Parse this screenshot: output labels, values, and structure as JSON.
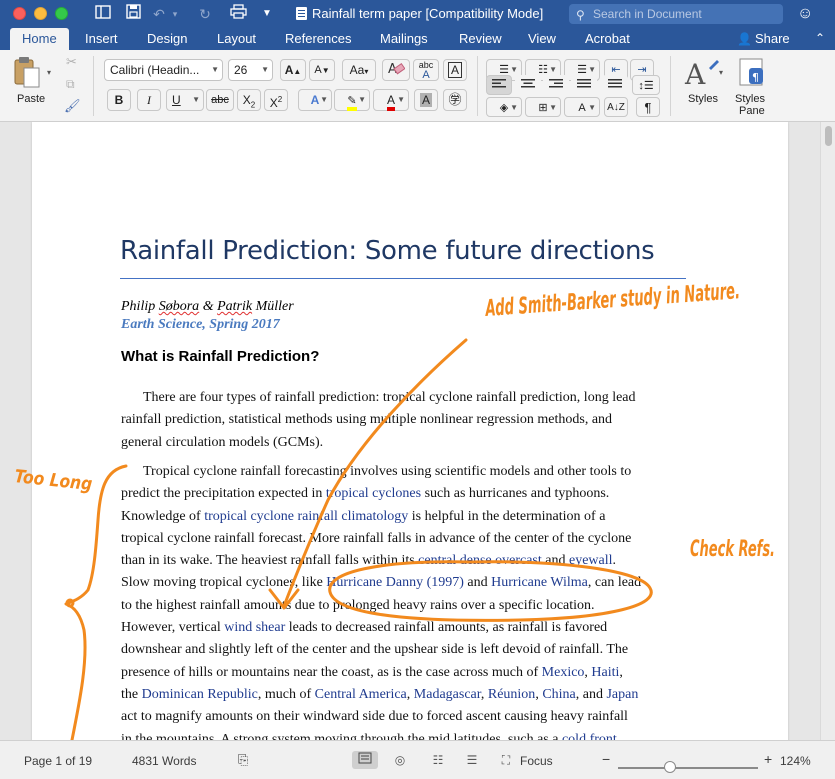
{
  "window": {
    "title": "Rainfall term paper [Compatibility Mode]",
    "search_placeholder": "Search in Document"
  },
  "ribbon_tabs": [
    "Home",
    "Insert",
    "Design",
    "Layout",
    "References",
    "Mailings",
    "Review",
    "View",
    "Acrobat"
  ],
  "share_label": "Share",
  "ribbon": {
    "paste_label": "Paste",
    "font_name": "Calibri (Headin...",
    "font_size": "26",
    "styles_label": "Styles",
    "styles_pane_label_1": "Styles",
    "styles_pane_label_2": "Pane"
  },
  "document": {
    "title": "Rainfall Prediction: Some future directions",
    "authors_a": "Philip",
    "authors_b": "Søbora",
    "authors_c": "&",
    "authors_d": "Patrik",
    "authors_e": "Müller",
    "course": "Earth Science, Spring 2017",
    "heading": "What is Rainfall Prediction?",
    "para1": [
      "There are four types of rainfall prediction: tropical cyclone rainfall prediction, long lead",
      "rainfall prediction, statistical methods using multiple nonlinear regression methods, and",
      "general circulation models (GCMs)."
    ],
    "para2": {
      "l1": "Tropical cyclone rainfall forecasting involves using scientific models and other tools to",
      "l2a": "predict the precipitation expected in ",
      "l2link": "tropical cyclones",
      "l2b": " such as hurricanes and typhoons.",
      "l3a": "Knowledge of ",
      "l3link": "tropical cyclone rainfall climatology",
      "l3b": " is helpful in the determination of a",
      "l4": "tropical cyclone rainfall forecast. More rainfall falls in advance of the center of the cyclone",
      "l5a": "than in its wake. The heaviest rainfall falls within its ",
      "l5link1": "central dense overcast",
      "l5b": " and ",
      "l5link2": "eyewall",
      "l5c": ".",
      "l6a": "Slow moving tropical cyclones, like ",
      "l6link1": "Hurricane Danny (1997)",
      "l6b": " and ",
      "l6link2": "Hurricane Wilma",
      "l6c": ", can lead",
      "l7": "to the highest rainfall amounts due to prolonged heavy rains over a specific location.",
      "l8a": "However, vertical ",
      "l8link": "wind shear",
      "l8b": " leads to decreased rainfall amounts, as rainfall is favored",
      "l9": "downshear and slightly left of the center and the upshear side is left devoid of rainfall. The",
      "l10a": "presence of hills or mountains near the coast, as is the case across much of ",
      "l10link1": "Mexico",
      "l10b": ", ",
      "l10link2": "Haiti",
      "l10c": ",",
      "l11a": "the ",
      "l11link1": "Dominican Republic",
      "l11b": ", much of ",
      "l11link2": "Central America",
      "l11c": ", ",
      "l11link3": "Madagascar",
      "l11d": ", ",
      "l11link4": "Réunion",
      "l11e": ", ",
      "l11link5": "China",
      "l11f": ", and ",
      "l11link6": "Japan",
      "l12": "act to magnify amounts on their windward side due to forced ascent causing heavy rainfall",
      "l13a": "in the mountains. A strong system moving through the mid latitudes, such as a ",
      "l13link": "cold front"
    }
  },
  "annotations": {
    "note_top": "Add Smith-Barker study in Nature.",
    "note_left": "Too Long",
    "note_right": "Check Refs."
  },
  "status": {
    "page": "Page 1 of 19",
    "words": "4831 Words",
    "focus": "Focus",
    "zoom": "124%"
  },
  "colors": {
    "word_blue": "#2b579a",
    "title_navy": "#1f3864",
    "ink_orange": "#f28a1e",
    "link_blue": "#1f3b8f"
  }
}
